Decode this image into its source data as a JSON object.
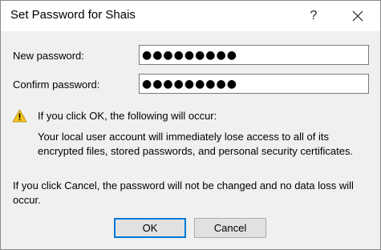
{
  "window": {
    "title": "Set Password for Shais",
    "help_label": "?"
  },
  "form": {
    "new_password_label": "New password:",
    "new_password_value": "●●●●●●●●●",
    "confirm_password_label": "Confirm password:",
    "confirm_password_value": "●●●●●●●●●"
  },
  "warning": {
    "icon": "warning-icon",
    "heading": "If you click OK, the following will occur:",
    "body": "Your local user account will immediately lose access to all of its encrypted files, stored passwords, and personal security certificates."
  },
  "cancel_note": "If you click Cancel, the password will not be changed and no data loss will occur.",
  "buttons": {
    "ok": "OK",
    "cancel": "Cancel"
  }
}
